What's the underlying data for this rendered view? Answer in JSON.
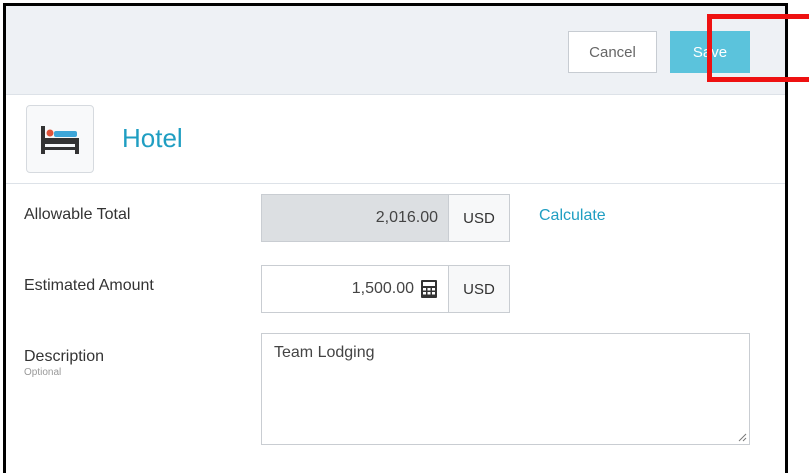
{
  "header": {
    "cancel_label": "Cancel",
    "save_label": "Save"
  },
  "expense": {
    "title": "Hotel",
    "icon": "bed-icon"
  },
  "form": {
    "allowable_total": {
      "label": "Allowable Total",
      "value": "2,016.00",
      "currency": "USD",
      "action_label": "Calculate"
    },
    "estimated_amount": {
      "label": "Estimated Amount",
      "value": "1,500.00",
      "currency": "USD",
      "icon": "calculator-icon"
    },
    "description": {
      "label": "Description",
      "sublabel": "Optional",
      "value": "Team Lodging"
    }
  },
  "colors": {
    "accent": "#1f9ec2",
    "save_button": "#5bc3dc",
    "annotation": "#ee1111"
  }
}
